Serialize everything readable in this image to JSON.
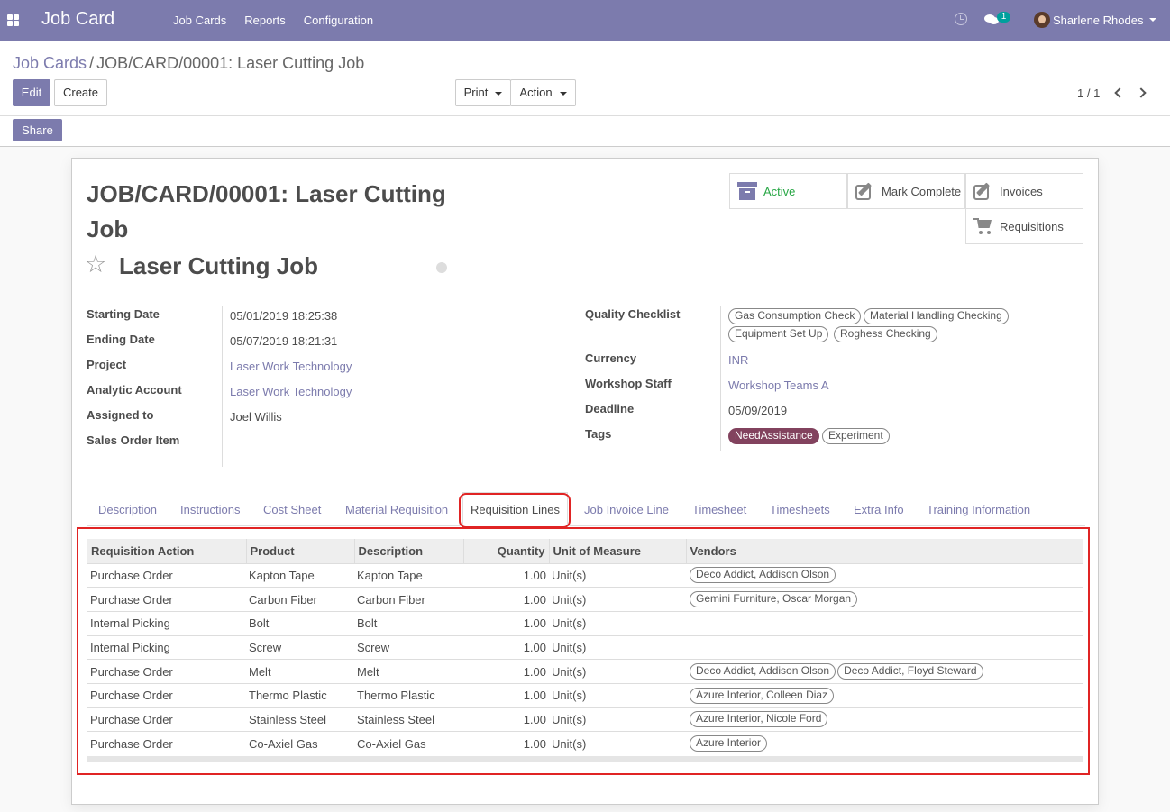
{
  "navbar": {
    "app_title": "Job Card",
    "menu": [
      "Job Cards",
      "Reports",
      "Configuration"
    ],
    "messages_count": "1",
    "user_name": "Sharlene Rhodes",
    "icons": [
      "apps-icon",
      "clock-icon",
      "chat-icon",
      "avatar"
    ]
  },
  "breadcrumb": {
    "parent": "Job Cards",
    "separator": "/",
    "current": "JOB/CARD/00001: Laser Cutting Job"
  },
  "toolbar": {
    "edit_label": "Edit",
    "create_label": "Create",
    "print_label": "Print",
    "action_label": "Action",
    "share_label": "Share",
    "pager": "1 / 1"
  },
  "record": {
    "title": "JOB/CARD/00001: Laser Cutting Job",
    "name": "Laser Cutting Job",
    "smart_buttons": {
      "active": "Active",
      "mark_complete": "Mark Complete",
      "invoices": "Invoices",
      "requisitions": "Requisitions"
    },
    "left_fields": [
      {
        "label": "Starting Date",
        "value": "05/01/2019 18:25:38",
        "link": false
      },
      {
        "label": "Ending Date",
        "value": "05/07/2019 18:21:31",
        "link": false
      },
      {
        "label": "Project",
        "value": "Laser Work Technology",
        "link": true
      },
      {
        "label": "Analytic Account",
        "value": "Laser Work Technology",
        "link": true
      },
      {
        "label": "Assigned to",
        "value": "Joel Willis",
        "link": false
      },
      {
        "label": "Sales Order Item",
        "value": "",
        "link": false
      }
    ],
    "right_fields": {
      "quality_checklist_label": "Quality Checklist",
      "quality_checklist": [
        "Gas Consumption Check",
        "Material Handling Checking",
        "Equipment Set Up",
        "Roghess Checking"
      ],
      "currency_label": "Currency",
      "currency": "INR",
      "workshop_staff_label": "Workshop Staff",
      "workshop_staff": "Workshop Teams A",
      "deadline_label": "Deadline",
      "deadline": "05/09/2019",
      "tags_label": "Tags",
      "tags": [
        "NeedAssistance",
        "Experiment"
      ]
    },
    "colors": {
      "accent": "#7c7bad",
      "active_green": "#28a745",
      "tag_filled": "#82425e",
      "highlight_red": "#e02424"
    }
  },
  "tabs": [
    "Description",
    "Instructions",
    "Cost Sheet",
    "Material Requisition",
    "Requisition Lines",
    "Job Invoice Line",
    "Timesheet",
    "Timesheets",
    "Extra Info",
    "Training Information"
  ],
  "active_tab": "Requisition Lines",
  "requisition_lines": {
    "columns": [
      "Requisition Action",
      "Product",
      "Description",
      "Quantity",
      "Unit of Measure",
      "Vendors"
    ],
    "rows": [
      {
        "action": "Purchase Order",
        "product": "Kapton Tape",
        "description": "Kapton Tape",
        "quantity": "1.00",
        "uom": "Unit(s)",
        "vendors": [
          "Deco Addict, Addison Olson"
        ]
      },
      {
        "action": "Purchase Order",
        "product": "Carbon Fiber",
        "description": "Carbon Fiber",
        "quantity": "1.00",
        "uom": "Unit(s)",
        "vendors": [
          "Gemini Furniture, Oscar Morgan"
        ]
      },
      {
        "action": "Internal Picking",
        "product": "Bolt",
        "description": "Bolt",
        "quantity": "1.00",
        "uom": "Unit(s)",
        "vendors": []
      },
      {
        "action": "Internal Picking",
        "product": "Screw",
        "description": "Screw",
        "quantity": "1.00",
        "uom": "Unit(s)",
        "vendors": []
      },
      {
        "action": "Purchase Order",
        "product": "Melt",
        "description": "Melt",
        "quantity": "1.00",
        "uom": "Unit(s)",
        "vendors": [
          "Deco Addict, Addison Olson",
          "Deco Addict, Floyd Steward"
        ]
      },
      {
        "action": "Purchase Order",
        "product": "Thermo Plastic",
        "description": "Thermo Plastic",
        "quantity": "1.00",
        "uom": "Unit(s)",
        "vendors": [
          "Azure Interior, Colleen Diaz"
        ]
      },
      {
        "action": "Purchase Order",
        "product": "Stainless Steel",
        "description": "Stainless Steel",
        "quantity": "1.00",
        "uom": "Unit(s)",
        "vendors": [
          "Azure Interior, Nicole Ford"
        ]
      },
      {
        "action": "Purchase Order",
        "product": "Co-Axiel Gas",
        "description": "Co-Axiel Gas",
        "quantity": "1.00",
        "uom": "Unit(s)",
        "vendors": [
          "Azure Interior"
        ]
      }
    ]
  }
}
